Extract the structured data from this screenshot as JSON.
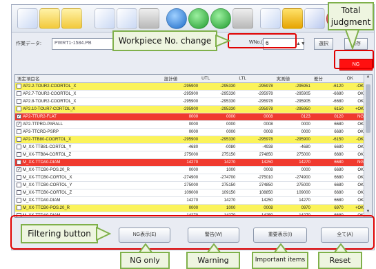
{
  "toolbar": {
    "icons": [
      "new-document-icon",
      "open-folder-icon",
      "folder-icon",
      "save-icon",
      "save-as-icon",
      "print-icon",
      "refresh-icon",
      "back-icon",
      "forward-icon",
      "settings-icon",
      "export-icon",
      "warning-icon",
      "edit-icon",
      "close-icon",
      "info-icon"
    ]
  },
  "header": {
    "file_label": "作業データ:",
    "file_path": "PWRT1-1584.PB",
    "number_label": "WNo.(D)",
    "number_value": "6",
    "btn1": "選択",
    "btn2": "保存"
  },
  "total": {
    "label": "NG"
  },
  "table": {
    "columns": [
      "測定項目名",
      "設計値",
      "UTL",
      "LTL",
      "実測値",
      "差分",
      "OK"
    ],
    "rows": [
      {
        "checked": false,
        "name": "AP2.2-TOUR2-COORTOL_X",
        "status": "warn",
        "values": [
          "-295900",
          "-295330",
          "-295978",
          "-295951",
          "-6120",
          "-OK"
        ]
      },
      {
        "checked": false,
        "name": "AP2.7-TOUR2-COORTOL_X",
        "status": "normal",
        "values": [
          "-295900",
          "-295330",
          "-295978",
          "-295905",
          "-6680",
          "OK"
        ]
      },
      {
        "checked": false,
        "name": "AP2.8-TOUR2-COORTOL_X",
        "status": "normal",
        "values": [
          "-295900",
          "-295330",
          "-295978",
          "-295905",
          "-6680",
          "OK"
        ]
      },
      {
        "checked": false,
        "name": "AP2.10-TOUR7-CORTOL_X",
        "status": "warn",
        "values": [
          "-295900",
          "-295330",
          "-295978",
          "-295950",
          "6150",
          "+OK"
        ]
      },
      {
        "checked": true,
        "name": "AP2-TTUR2-FLAT",
        "status": "ng",
        "values": [
          "0000",
          "0000",
          "0008",
          "0123",
          "0120",
          "NG"
        ]
      },
      {
        "checked": true,
        "name": "AP2-TTPRD-PARALL",
        "status": "normal",
        "values": [
          "0000",
          "0000",
          "0008",
          "0000",
          "6680",
          "OK"
        ]
      },
      {
        "checked": false,
        "name": "AP3-TTCRD-PSRP",
        "status": "normal",
        "values": [
          "0000",
          "0000",
          "0008",
          "0000",
          "6680",
          "OK"
        ]
      },
      {
        "checked": false,
        "name": "AP2-TTB80-COORTOL_X",
        "status": "warn",
        "values": [
          "-295900",
          "-295330",
          "-295978",
          "-295900",
          "-6150",
          "-OK"
        ]
      },
      {
        "checked": false,
        "name": "M_XX-TTB81-CORTOL_Y",
        "status": "normal",
        "values": [
          "-4680",
          "-0080",
          "-4938",
          "-4680",
          "6680",
          "OK"
        ]
      },
      {
        "checked": false,
        "name": "M_XX-TTB84-CORTOL_Z",
        "status": "normal",
        "values": [
          "275000",
          "275150",
          "274850",
          "275000",
          "6680",
          "OK"
        ]
      },
      {
        "checked": false,
        "name": "M_XX-TTDA0-DIAM",
        "status": "ng",
        "values": [
          "14270",
          "14270",
          "14250",
          "14270",
          "6680",
          "NG"
        ]
      },
      {
        "checked": true,
        "name": "M_XX-TTCB0-POS.20_R",
        "status": "normal",
        "values": [
          "0000",
          "1000",
          "0008",
          "0000",
          "6680",
          "OK"
        ]
      },
      {
        "checked": false,
        "name": "M_XX-TTCB0-CORTOL_X",
        "status": "normal",
        "values": [
          "-274900",
          "-274700",
          "-275010",
          "-274900",
          "6680",
          "OK"
        ]
      },
      {
        "checked": false,
        "name": "M_XX-TTCB0-CORTOL_Y",
        "status": "normal",
        "values": [
          "275000",
          "275150",
          "274850",
          "275000",
          "6680",
          "OK"
        ]
      },
      {
        "checked": false,
        "name": "M_XX-TTCB0-CORTOL_Z",
        "status": "normal",
        "values": [
          "109000",
          "109150",
          "108850",
          "109000",
          "6680",
          "OK"
        ]
      },
      {
        "checked": false,
        "name": "M_XX-TTDA0-DIAM",
        "status": "normal",
        "values": [
          "14270",
          "14270",
          "14250",
          "14270",
          "6680",
          "OK"
        ]
      },
      {
        "checked": false,
        "name": "M_XX-TTCB0-POS.20_R",
        "status": "warn",
        "values": [
          "0000",
          "1000",
          "0008",
          "0970",
          "6970",
          "+OK"
        ]
      },
      {
        "checked": false,
        "name": "M_XX-TTDA0-DIAM",
        "status": "normal",
        "values": [
          "14270",
          "14270",
          "14250",
          "14270",
          "6680",
          "OK"
        ]
      }
    ]
  },
  "filters": {
    "ng_only": "NG表示(E)",
    "warning": "警告(W)",
    "important": "重要表示(I)",
    "reset": "全て(A)"
  },
  "annotations": {
    "workpiece": "Workpiece No. change",
    "total_line1": "Total",
    "total_line2": "judgment",
    "filtering": "Filtering button",
    "ng_only": "NG only",
    "warning": "Warning",
    "important": "Important items",
    "reset": "Reset"
  },
  "colors": {
    "warn": "#fbf35a",
    "ng": "#f03a2f",
    "annotation_border": "#7fb04a",
    "highlight": "#e00000"
  }
}
